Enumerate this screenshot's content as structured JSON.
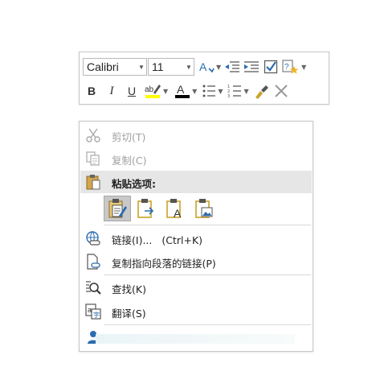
{
  "toolbar": {
    "font_name": "Calibri",
    "font_size": "11",
    "bold_label": "B",
    "italic_label": "I",
    "underline_label": "U",
    "icons": [
      "grow-shrink-font-icon",
      "decrease-indent-icon",
      "increase-indent-icon",
      "checkbox-style-icon",
      "styles-icon",
      "highlight-icon",
      "font-color-icon",
      "bullets-icon",
      "numbering-icon",
      "format-painter-icon",
      "clear-format-icon"
    ],
    "highlight_color": "#ffff00",
    "font_color": "#000000"
  },
  "menu": {
    "cut": "剪切(T)",
    "copy": "复制(C)",
    "paste_options": "粘贴选项:",
    "link": "链接(I)...",
    "link_shortcut": "(Ctrl+K)",
    "copy_paragraph_link": "复制指向段落的链接(P)",
    "find": "查找(K)",
    "translate": "翻译(S)"
  },
  "colors": {
    "accent": "#2b6cb0",
    "paste_selected": "#c8c8c8",
    "header_bg": "#e6e6e6"
  }
}
